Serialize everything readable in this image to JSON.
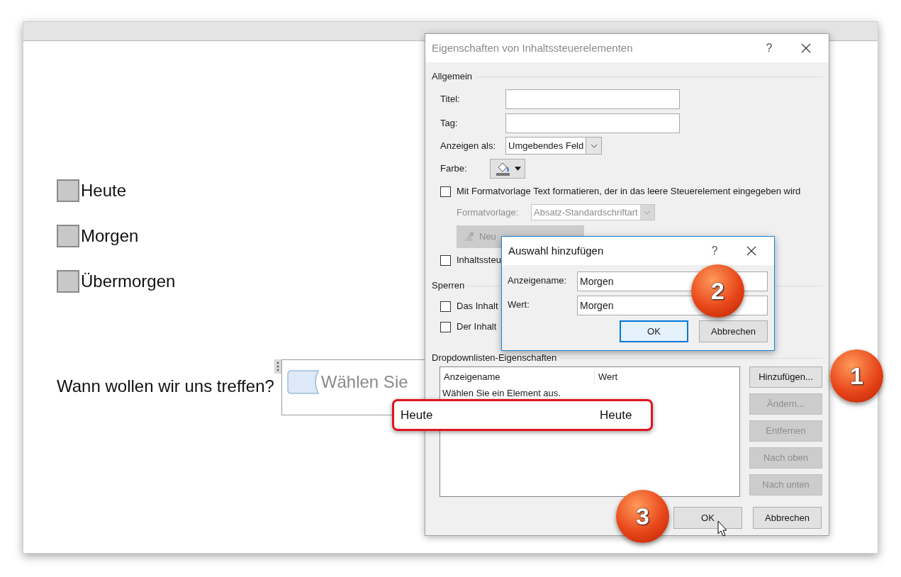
{
  "document": {
    "checkbox_items": [
      {
        "label": "Heute",
        "checked": false
      },
      {
        "label": "Morgen",
        "checked": false
      },
      {
        "label": "Übermorgen",
        "checked": false
      }
    ],
    "question": "Wann wollen wir uns treffen?",
    "content_control": {
      "placeholder": "Wählen Sie"
    }
  },
  "properties_dialog": {
    "title": "Eigenschaften von Inhaltssteuerelementen",
    "help": "?",
    "general_heading": "Allgemein",
    "text_fields": [
      {
        "label": "Titel:"
      },
      {
        "label": "Tag:"
      }
    ],
    "show_as": {
      "label": "Anzeigen als:",
      "value": "Umgebendes Feld"
    },
    "color": {
      "label": "Farbe:"
    },
    "style_checkbox": {
      "label": "Mit Formatvorlage Text formatieren, der in das leere Steuerelement eingegeben wird",
      "checked": false
    },
    "style_select": {
      "label": "Formatvorlage:",
      "value": "Absatz-Standardschriftart",
      "disabled": true
    },
    "new_style_button": {
      "label": "Neu",
      "disabled": true
    },
    "remove_checkbox": {
      "label": "Inhaltssteu",
      "checked": false
    },
    "lock_heading": "Sperren",
    "lock_checkboxes": [
      {
        "label": "Das Inhalt",
        "checked": false
      },
      {
        "label": "Der Inhalt",
        "checked": false
      }
    ],
    "dropdown_heading": "Dropdownlisten-Eigenschaften",
    "list": {
      "columns": [
        "Anzeigename",
        "Wert"
      ],
      "rows": [
        {
          "name": "Wählen Sie ein Element aus."
        }
      ]
    },
    "side_buttons": [
      {
        "label": "Hinzufügen...",
        "disabled": false
      },
      {
        "label": "Ändern...",
        "disabled": true
      },
      {
        "label": "Entfernen",
        "disabled": true
      },
      {
        "label": "Nach oben",
        "disabled": true
      },
      {
        "label": "Nach unten",
        "disabled": true
      }
    ],
    "buttons": [
      {
        "label": "OK",
        "default": false
      },
      {
        "label": "Abbrechen",
        "default": false
      }
    ]
  },
  "add_dialog": {
    "title": "Auswahl hinzufügen",
    "help": "?",
    "fields": [
      {
        "label": "Anzeigename:",
        "value": "Morgen"
      },
      {
        "label": "Wert:",
        "value": "Morgen"
      }
    ],
    "buttons": [
      {
        "label": "OK",
        "default": true
      },
      {
        "label": "Abbrechen",
        "default": false
      }
    ]
  },
  "callout": {
    "name": "Heute",
    "value": "Heute"
  },
  "badges": [
    "1",
    "2",
    "3"
  ]
}
